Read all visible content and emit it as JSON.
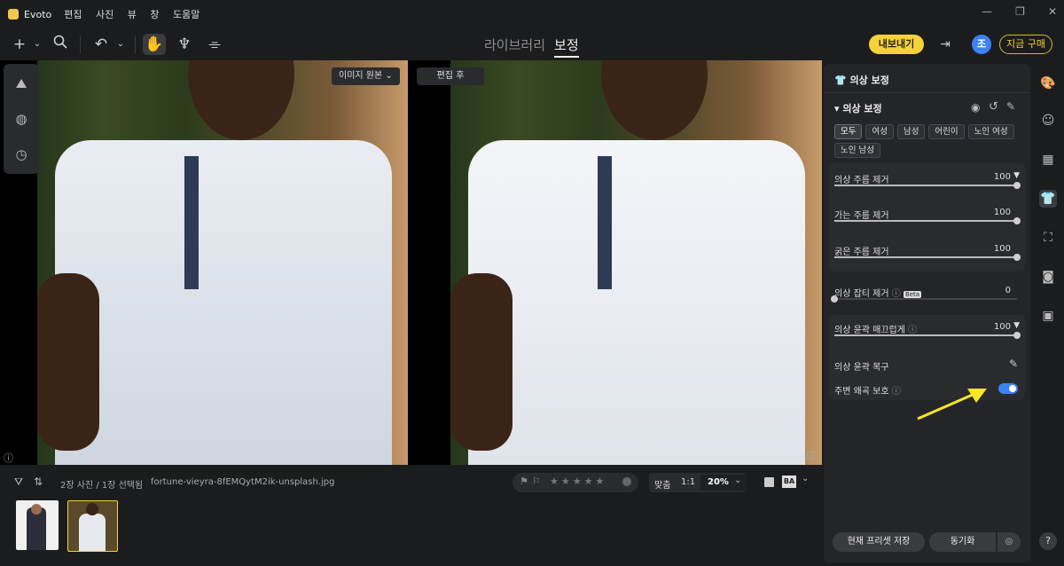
{
  "app": {
    "name": "Evoto",
    "menu": [
      "편집",
      "사진",
      "뷰",
      "창",
      "도움말"
    ]
  },
  "toolbar": {
    "tabs": {
      "library": "라이브러리",
      "edit": "보정"
    },
    "export_label": "내보내기",
    "avatar_initial": "조",
    "buy_label": "지금 구매"
  },
  "canvas": {
    "original_label": "이미지 원본",
    "after_label": "편집 후"
  },
  "bottombar": {
    "photo_count": "2장 사진 / 1장 선택됨",
    "filename": "fortune-vieyra-8fEMQytM2ik-unsplash.jpg",
    "fit_label": "맞춤",
    "ratio_label": "1:1",
    "zoom": "20%",
    "rating_stars": 0
  },
  "panel": {
    "title": "의상 보정",
    "section_title": "의상 보정",
    "chips": [
      {
        "label": "모두",
        "active": true
      },
      {
        "label": "여성",
        "active": false
      },
      {
        "label": "남성",
        "active": false
      },
      {
        "label": "어린이",
        "active": false
      },
      {
        "label": "노인 여성",
        "active": false
      },
      {
        "label": "노인 남성",
        "active": false
      }
    ],
    "sliders": {
      "wrinkle_removal": {
        "label": "의상 주름 제거",
        "value": "100",
        "level": 1.0
      },
      "fine_wrinkle": {
        "label": "가는 주름 제거",
        "value": "100",
        "level": 1.0
      },
      "thick_wrinkle": {
        "label": "굵은 주름 제거",
        "value": "100",
        "level": 1.0
      },
      "lint_removal": {
        "label": "의상 잡티 제거",
        "badge": "Beta",
        "value": "0",
        "level": 0.0
      },
      "contour_smooth": {
        "label": "의상 윤곽 매끄럽게",
        "value": "100",
        "level": 1.0
      }
    },
    "contour_restore_label": "의상 윤곽 복구",
    "protect_label": "주변 왜곡 보호",
    "protect_on": true,
    "save_preset_label": "현재 프리셋 저장",
    "sync_label": "동기화"
  },
  "help_label": "?"
}
